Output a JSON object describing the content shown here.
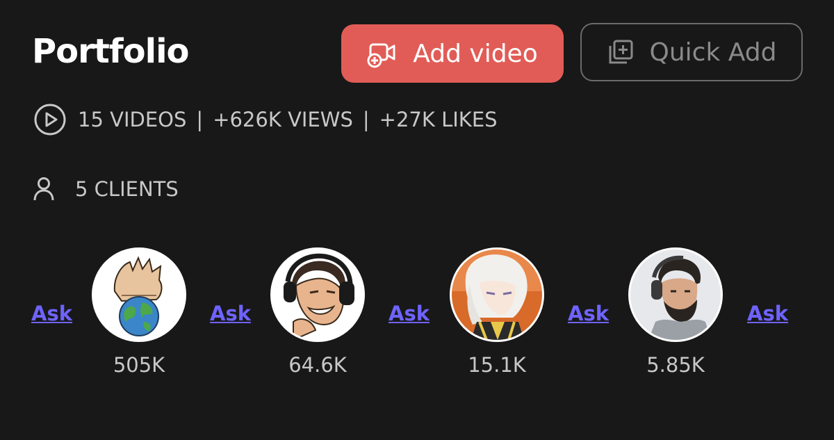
{
  "header": {
    "title": "Portfolio",
    "add_video_label": "Add video",
    "quick_add_label": "Quick Add"
  },
  "stats": {
    "videos": "15 VIDEOS",
    "views": "+626K VIEWS",
    "likes": "+27K LIKES",
    "separator": "|"
  },
  "clients": {
    "count_label": "5 CLIENTS",
    "ask_label": "Ask",
    "items": [
      {
        "count": "505K",
        "avatar": "hand-globe-avatar"
      },
      {
        "count": "64.6K",
        "avatar": "headphones-cartoon-avatar"
      },
      {
        "count": "15.1K",
        "avatar": "anime-character-avatar"
      },
      {
        "count": "5.85K",
        "avatar": "bearded-man-avatar"
      }
    ]
  },
  "colors": {
    "background": "#181818",
    "accent": "#e15c56",
    "link": "#6f63ff",
    "muted": "#c8c8c8"
  }
}
